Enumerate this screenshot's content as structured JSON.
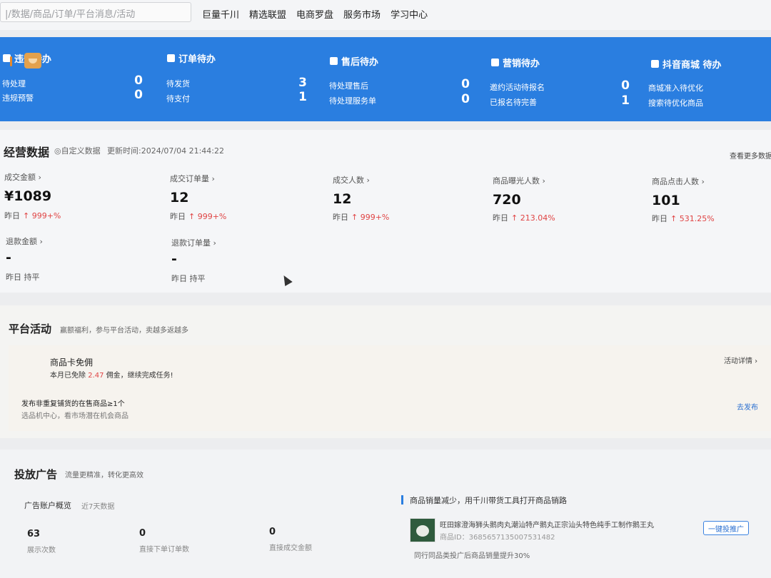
{
  "search": {
    "value": "|/数据/商品/订单/平台消息/活动"
  },
  "nav": [
    "巨量千川",
    "精选联盟",
    "电商罗盘",
    "服务市场",
    "学习中心"
  ],
  "todo": [
    {
      "title": "违规待办",
      "rows": [
        {
          "label": "待处理",
          "value": "0"
        },
        {
          "label": "违规预警",
          "value": "0"
        }
      ]
    },
    {
      "title": "订单待办",
      "rows": [
        {
          "label": "待发货",
          "value": "3"
        },
        {
          "label": "待支付",
          "value": "1"
        }
      ]
    },
    {
      "title": "售后待办",
      "rows": [
        {
          "label": "待处理售后",
          "value": "0"
        },
        {
          "label": "待处理服务单",
          "value": "0"
        }
      ]
    },
    {
      "title": "营销待办",
      "rows": [
        {
          "label": "邀约活动待报名",
          "value": "0"
        },
        {
          "label": "已报名待完善",
          "value": "1"
        }
      ]
    },
    {
      "title": "抖音商城 待办",
      "rows": [
        {
          "label": "商城准入待优化",
          "value": ""
        },
        {
          "label": "搜索待优化商品",
          "value": ""
        }
      ]
    }
  ],
  "business": {
    "title": "经营数据",
    "custom": "◎自定义数据",
    "updated": "更新时间:2024/07/04 21:44:22",
    "more": "查看更多数据",
    "metrics": [
      {
        "label": "成交金额 ›",
        "value": "¥1089",
        "cmp_label": "昨日",
        "cmp": "↑ 999+%"
      },
      {
        "label": "成交订单量 ›",
        "value": "12",
        "cmp_label": "昨日",
        "cmp": "↑ 999+%"
      },
      {
        "label": "成交人数 ›",
        "value": "12",
        "cmp_label": "昨日",
        "cmp": "↑ 999+%"
      },
      {
        "label": "商品曝光人数 ›",
        "value": "720",
        "cmp_label": "昨日",
        "cmp": "↑ 213.04%"
      },
      {
        "label": "商品点击人数 ›",
        "value": "101",
        "cmp_label": "昨日",
        "cmp": "↑ 531.25%"
      },
      {
        "label": "退款金额 ›",
        "value": "-",
        "cmp_label": "昨日 持平",
        "cmp": ""
      },
      {
        "label": "退款订单量 ›",
        "value": "-",
        "cmp_label": "昨日 持平",
        "cmp": ""
      }
    ]
  },
  "activity": {
    "title": "平台活动",
    "subtitle": "赢额福利，参与平台活动，卖越多返越多",
    "card_title": "商品卡免佣",
    "card_desc_pre": "本月已免除",
    "card_amount": "2.47",
    "card_desc_post": "佣金，继续完成任务!",
    "detail_link": "活动详情 ›",
    "task_title": "发布非重复铺货的在售商品≥1个",
    "task_desc": "选品机中心，看市场潜在机会商品",
    "publish": "去发布"
  },
  "ads": {
    "title": "投放广告",
    "subtitle": "流量更精准，转化更高效",
    "overview_title": "广告账户概览",
    "overview_range": "近7天数据",
    "stats": [
      {
        "value": "63",
        "label": "展示次数"
      },
      {
        "value": "0",
        "label": "直接下单订单数"
      },
      {
        "value": "0",
        "label": "直接成交金额"
      }
    ],
    "promo_title": "商品销量减少，用千川带货工具打开商品销路",
    "product_name": "旺田嫁澄海狮头鹅肉丸潮汕特产鹅丸正宗汕头特色纯手工制作鹅王丸",
    "product_id": "商品ID：3685657135007531482",
    "promote_button": "一键投推广",
    "tip": "同行同品类投广后商品销量提升30%"
  }
}
